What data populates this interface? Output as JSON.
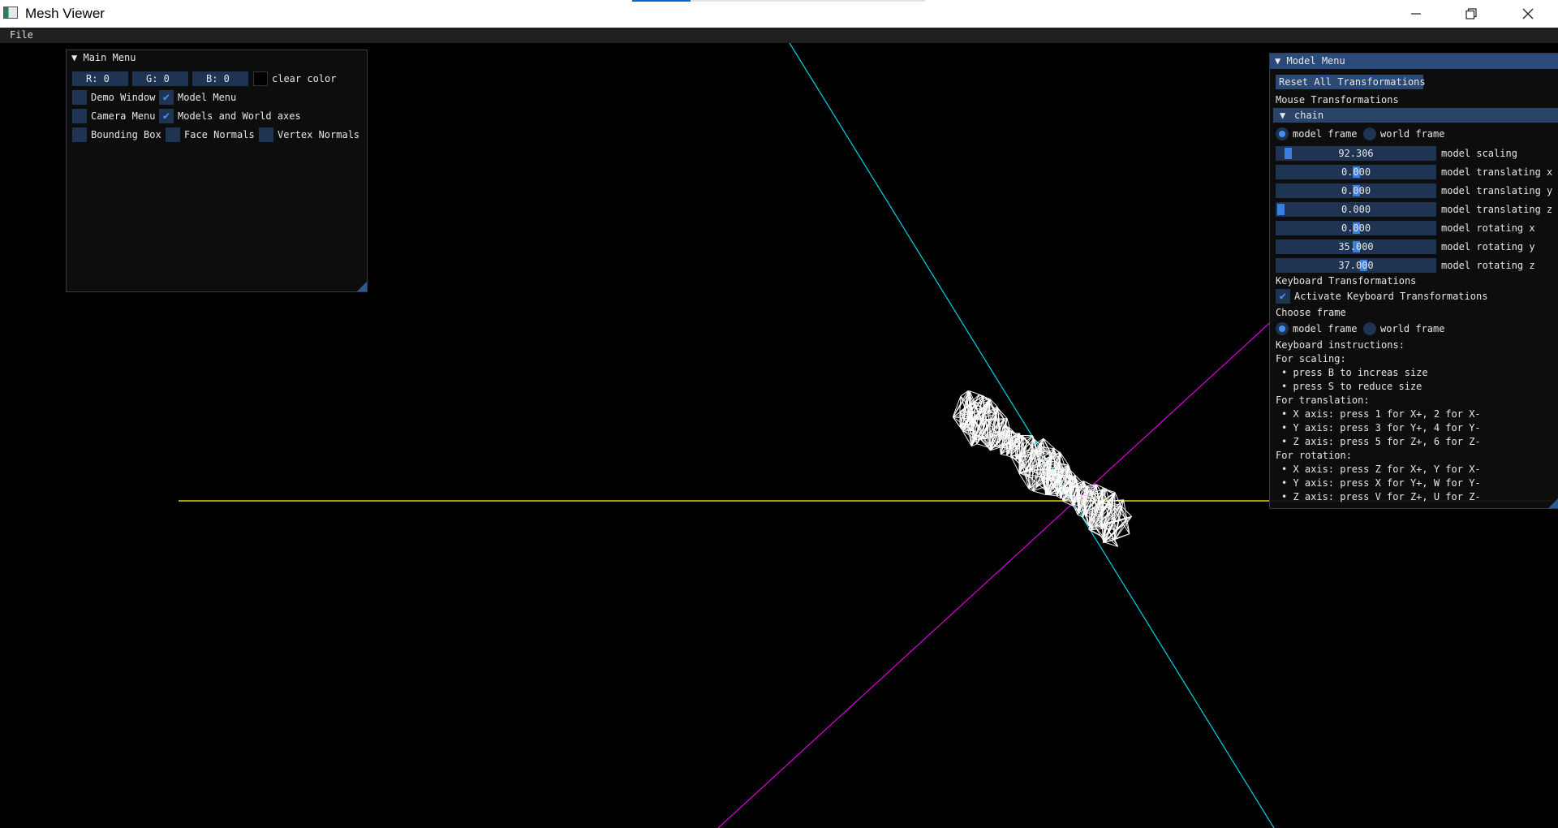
{
  "window": {
    "title": "Mesh Viewer",
    "icons": {
      "app": "app-icon",
      "minimize": "minimize-icon",
      "maximize": "restore-icon",
      "close": "close-icon"
    }
  },
  "menubar": {
    "file_label": "File"
  },
  "colors": {
    "x_axis": "#ffff00",
    "y_axis": "#00d8e8",
    "z_axis": "#e000e0",
    "mesh": "#ffffff",
    "accent": "#4a8ef5"
  },
  "main_menu": {
    "title": "Main Menu",
    "color_r": "R: 0",
    "color_g": "G: 0",
    "color_b": "B: 0",
    "clear_color_label": "clear color",
    "checkboxes": [
      {
        "label": "Demo Window",
        "checked": false
      },
      {
        "label": "Model Menu",
        "checked": true
      },
      {
        "label": "Camera Menu",
        "checked": false
      },
      {
        "label": "Models and World axes",
        "checked": true
      },
      {
        "label": "Bounding Box",
        "checked": false
      },
      {
        "label": "Face Normals",
        "checked": false
      },
      {
        "label": "Vertex Normals",
        "checked": false
      }
    ]
  },
  "model_menu": {
    "title": "Model Menu",
    "reset_button": "Reset All Transformations",
    "mouse_header": "Mouse Transformations",
    "model_header": "chain",
    "frame_model": "model frame",
    "frame_world": "world frame",
    "sliders": [
      {
        "label": "model scaling",
        "value": "92.306",
        "fraction": 0.05
      },
      {
        "label": "model translating x",
        "value": "0.000",
        "fraction": 0.5
      },
      {
        "label": "model translating y",
        "value": "0.000",
        "fraction": 0.5
      },
      {
        "label": "model translating z",
        "value": "0.000",
        "fraction": 0.0
      },
      {
        "label": "model rotating x",
        "value": "0.000",
        "fraction": 0.5
      },
      {
        "label": "model rotating y",
        "value": "35.000",
        "fraction": 0.5
      },
      {
        "label": "model rotating z",
        "value": "37.000",
        "fraction": 0.55
      }
    ],
    "keyboard_header": "Keyboard Transformations",
    "activate_keyboard": "Activate Keyboard Transformations",
    "activate_keyboard_checked": true,
    "choose_frame": "Choose frame",
    "instructions_title": "Keyboard instructions:",
    "scaling_title": "For scaling:",
    "scaling_lines": [
      "press B to increas size",
      "press S to reduce size"
    ],
    "translation_title": "For translation:",
    "translation_lines": [
      "X axis: press 1 for X+, 2 for X-",
      "Y axis: press 3 for Y+, 4 for Y-",
      "Z axis: press 5 for Z+, 6 for Z-"
    ],
    "rotation_title": "For rotation:",
    "rotation_lines": [
      "X axis: press Z for X+, Y for X-",
      "Y axis: press X for Y+, W for Y-",
      "Z axis: press V for Z+, U for Z-"
    ]
  }
}
